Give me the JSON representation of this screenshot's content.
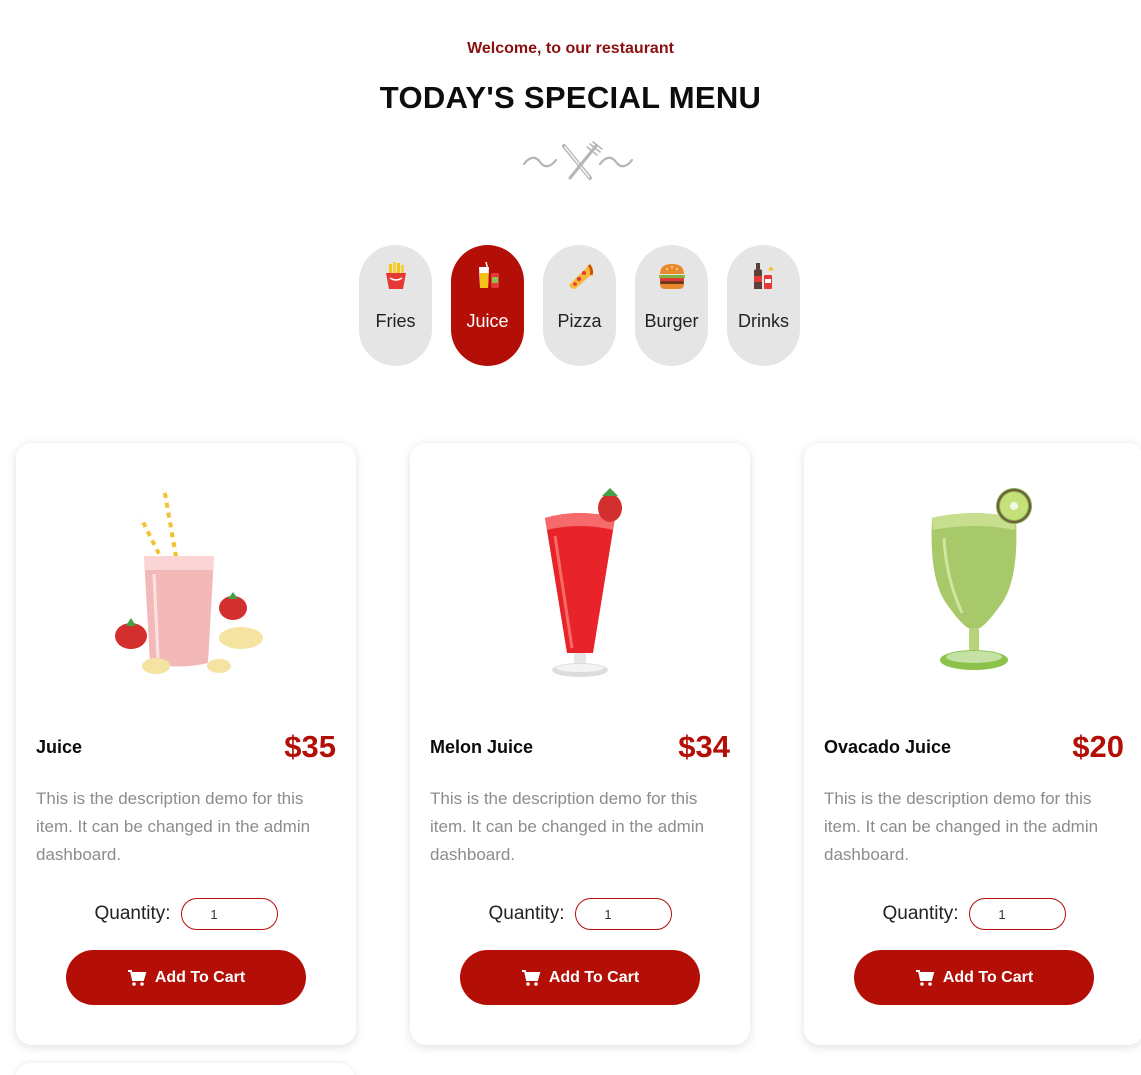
{
  "header": {
    "welcome": "Welcome, to our restaurant",
    "title": "TODAY'S SPECIAL MENU",
    "ornament_icon": "fork-knife-ornament-icon"
  },
  "categories": [
    {
      "label": "Fries",
      "icon": "fries-icon",
      "active": false
    },
    {
      "label": "Juice",
      "icon": "juice-icon",
      "active": true
    },
    {
      "label": "Pizza",
      "icon": "pizza-icon",
      "active": false
    },
    {
      "label": "Burger",
      "icon": "burger-icon",
      "active": false
    },
    {
      "label": "Drinks",
      "icon": "drinks-icon",
      "active": false
    }
  ],
  "products": [
    {
      "name": "Juice",
      "price": "$35",
      "description": "This is the description demo for this item. It can be changed in the admin dashboard.",
      "quantity_label": "Quantity:",
      "quantity_value": "1",
      "button_label": "Add To Cart",
      "image": "strawberry-banana-smoothie"
    },
    {
      "name": "Melon Juice",
      "price": "$34",
      "description": "This is the description demo for this item. It can be changed in the admin dashboard.",
      "quantity_label": "Quantity:",
      "quantity_value": "1",
      "button_label": "Add To Cart",
      "image": "red-melon-juice-glass"
    },
    {
      "name": "Ovacado Juice",
      "price": "$20",
      "description": "This is the description demo for this item. It can be changed in the admin dashboard.",
      "quantity_label": "Quantity:",
      "quantity_value": "1",
      "button_label": "Add To Cart",
      "image": "green-avocado-kiwi-juice"
    }
  ],
  "colors": {
    "accent": "#b30f06",
    "welcome_text": "#8b1010",
    "category_bg": "#e5e5e5",
    "description_text": "#8c8c8c"
  }
}
